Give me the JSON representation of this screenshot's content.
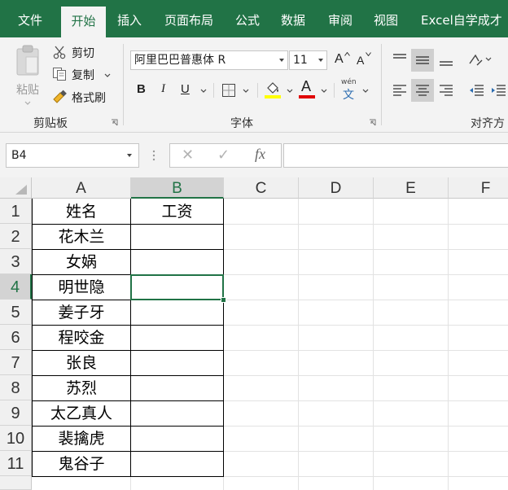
{
  "ribbon_tabs": [
    {
      "label": "文件",
      "active": false
    },
    {
      "label": "开始",
      "active": true
    },
    {
      "label": "插入",
      "active": false
    },
    {
      "label": "页面布局",
      "active": false
    },
    {
      "label": "公式",
      "active": false
    },
    {
      "label": "数据",
      "active": false
    },
    {
      "label": "审阅",
      "active": false
    },
    {
      "label": "视图",
      "active": false
    },
    {
      "label": "Excel自学成才",
      "active": false
    }
  ],
  "clipboard": {
    "group_label": "剪贴板",
    "paste_label": "粘贴",
    "cut_label": "剪切",
    "copy_label": "复制",
    "format_painter_label": "格式刷"
  },
  "font": {
    "group_label": "字体",
    "font_name": "阿里巴巴普惠体 R",
    "font_size": "11",
    "increase_label": "A",
    "decrease_label": "A",
    "bold": "B",
    "italic": "I",
    "underline": "U",
    "font_color_letter": "A",
    "phonetic_top": "wén",
    "phonetic_bottom": "文",
    "highlight_color": "#ffff00",
    "font_color": "#e00000"
  },
  "alignment": {
    "group_label": "对齐方"
  },
  "formula_bar": {
    "name_box": "B4",
    "fx": "fx",
    "cancel": "✕",
    "enter": "✓",
    "content": ""
  },
  "grid": {
    "columns": [
      "A",
      "B",
      "C",
      "D",
      "E",
      "F"
    ],
    "selected_column": "B",
    "rows": [
      "1",
      "2",
      "3",
      "4",
      "5",
      "6",
      "7",
      "8",
      "9",
      "10",
      "11"
    ],
    "selected_row": "4",
    "active_cell": "B4",
    "cells": [
      {
        "a": "姓名",
        "b": "工资"
      },
      {
        "a": "花木兰",
        "b": ""
      },
      {
        "a": "女娲",
        "b": ""
      },
      {
        "a": "明世隐",
        "b": ""
      },
      {
        "a": "姜子牙",
        "b": ""
      },
      {
        "a": "程咬金",
        "b": ""
      },
      {
        "a": "张良",
        "b": ""
      },
      {
        "a": "苏烈",
        "b": ""
      },
      {
        "a": "太乙真人",
        "b": ""
      },
      {
        "a": "裴擒虎",
        "b": ""
      },
      {
        "a": "鬼谷子",
        "b": ""
      }
    ]
  },
  "colors": {
    "brand_green": "#217346",
    "ribbon_bg": "#f3f3f3"
  }
}
